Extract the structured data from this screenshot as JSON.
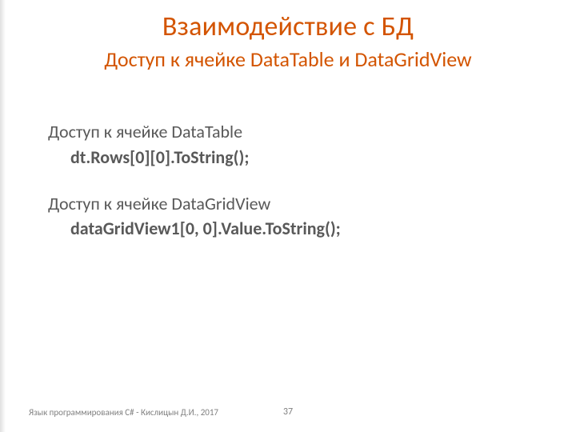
{
  "header": {
    "title": "Взаимодействие с БД",
    "subtitle": "Доступ к ячейке DataTable и DataGridView"
  },
  "body": {
    "dt_label": "Доступ к ячейке DataTable",
    "dt_code": "dt.Rows[0][0].ToString();",
    "dgv_label": "Доступ к ячейке DataGridView",
    "dgv_code": "dataGridView1[0, 0].Value.ToString();"
  },
  "footer": {
    "attribution": "Язык программирования C# - Кислицын Д.И., 2017",
    "page": "37"
  }
}
